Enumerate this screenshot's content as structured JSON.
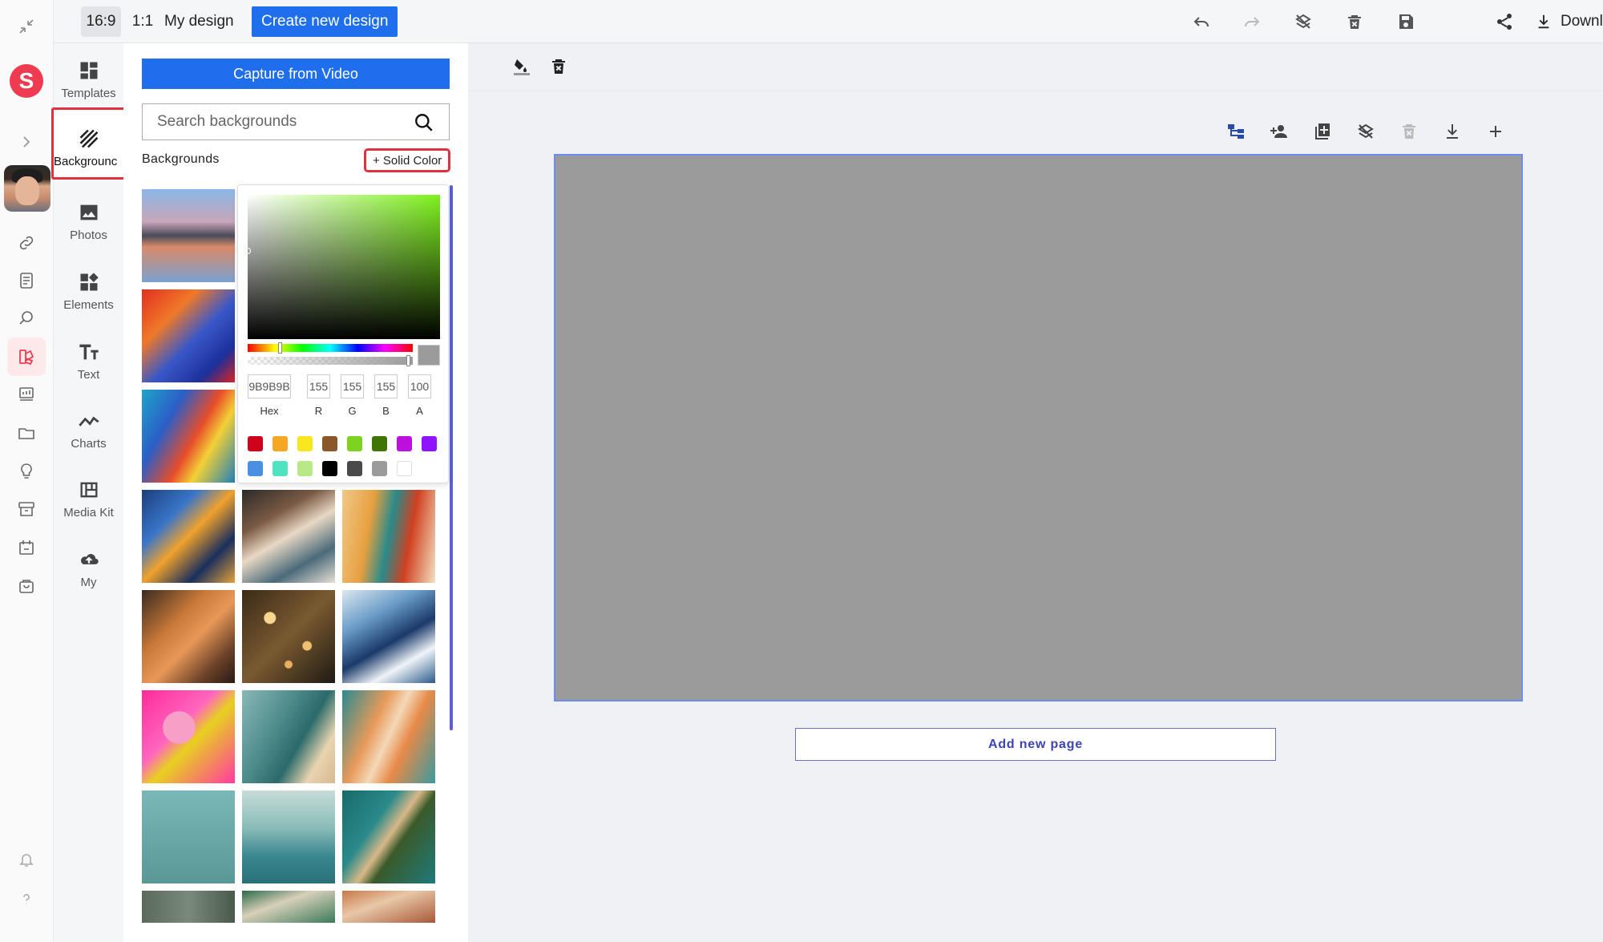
{
  "topbar": {
    "ratio_169": "16:9",
    "ratio_11": "1:1",
    "my_design": "My design",
    "create_new_design": "Create new design",
    "download": "Download"
  },
  "tools": [
    {
      "label": "Templates",
      "icon": "templates-icon"
    },
    {
      "label": "Backgrounds",
      "display": "Backgrounc",
      "icon": "backgrounds-icon"
    },
    {
      "label": "Photos",
      "icon": "photo-icon"
    },
    {
      "label": "Elements",
      "icon": "elements-icon"
    },
    {
      "label": "Text",
      "icon": "text-icon"
    },
    {
      "label": "Charts",
      "icon": "chart-icon"
    },
    {
      "label": "Media Kit",
      "icon": "media-kit-icon"
    },
    {
      "label": "My",
      "icon": "cloud-upload-icon"
    }
  ],
  "panel": {
    "capture_button": "Capture from Video",
    "search_placeholder": "Search backgrounds",
    "heading": "Backgrounds",
    "solid_color": "+ Solid Color"
  },
  "color_picker": {
    "hex": "9B9B9B",
    "r": "155",
    "g": "155",
    "b": "155",
    "a": "100",
    "labels": {
      "hex": "Hex",
      "r": "R",
      "g": "G",
      "b": "B",
      "a": "A"
    },
    "current_color": "#9b9b9b",
    "swatches_row1": [
      "#d0021b",
      "#f5a623",
      "#f8e71c",
      "#8b572a",
      "#7ed321",
      "#417505",
      "#bd10e0",
      "#9013fe"
    ],
    "swatches_row2": [
      "#4a90e2",
      "#50e3c2",
      "#b8e986",
      "#000000",
      "#4a4a4a",
      "#9b9b9b",
      "#ffffff"
    ]
  },
  "canvas": {
    "background_color": "#9b9b9b",
    "add_new_page": "Add new page"
  },
  "colors": {
    "accent_blue": "#1f6fed",
    "highlight_red": "#e0313f",
    "brand_red": "#ef3b4f"
  }
}
